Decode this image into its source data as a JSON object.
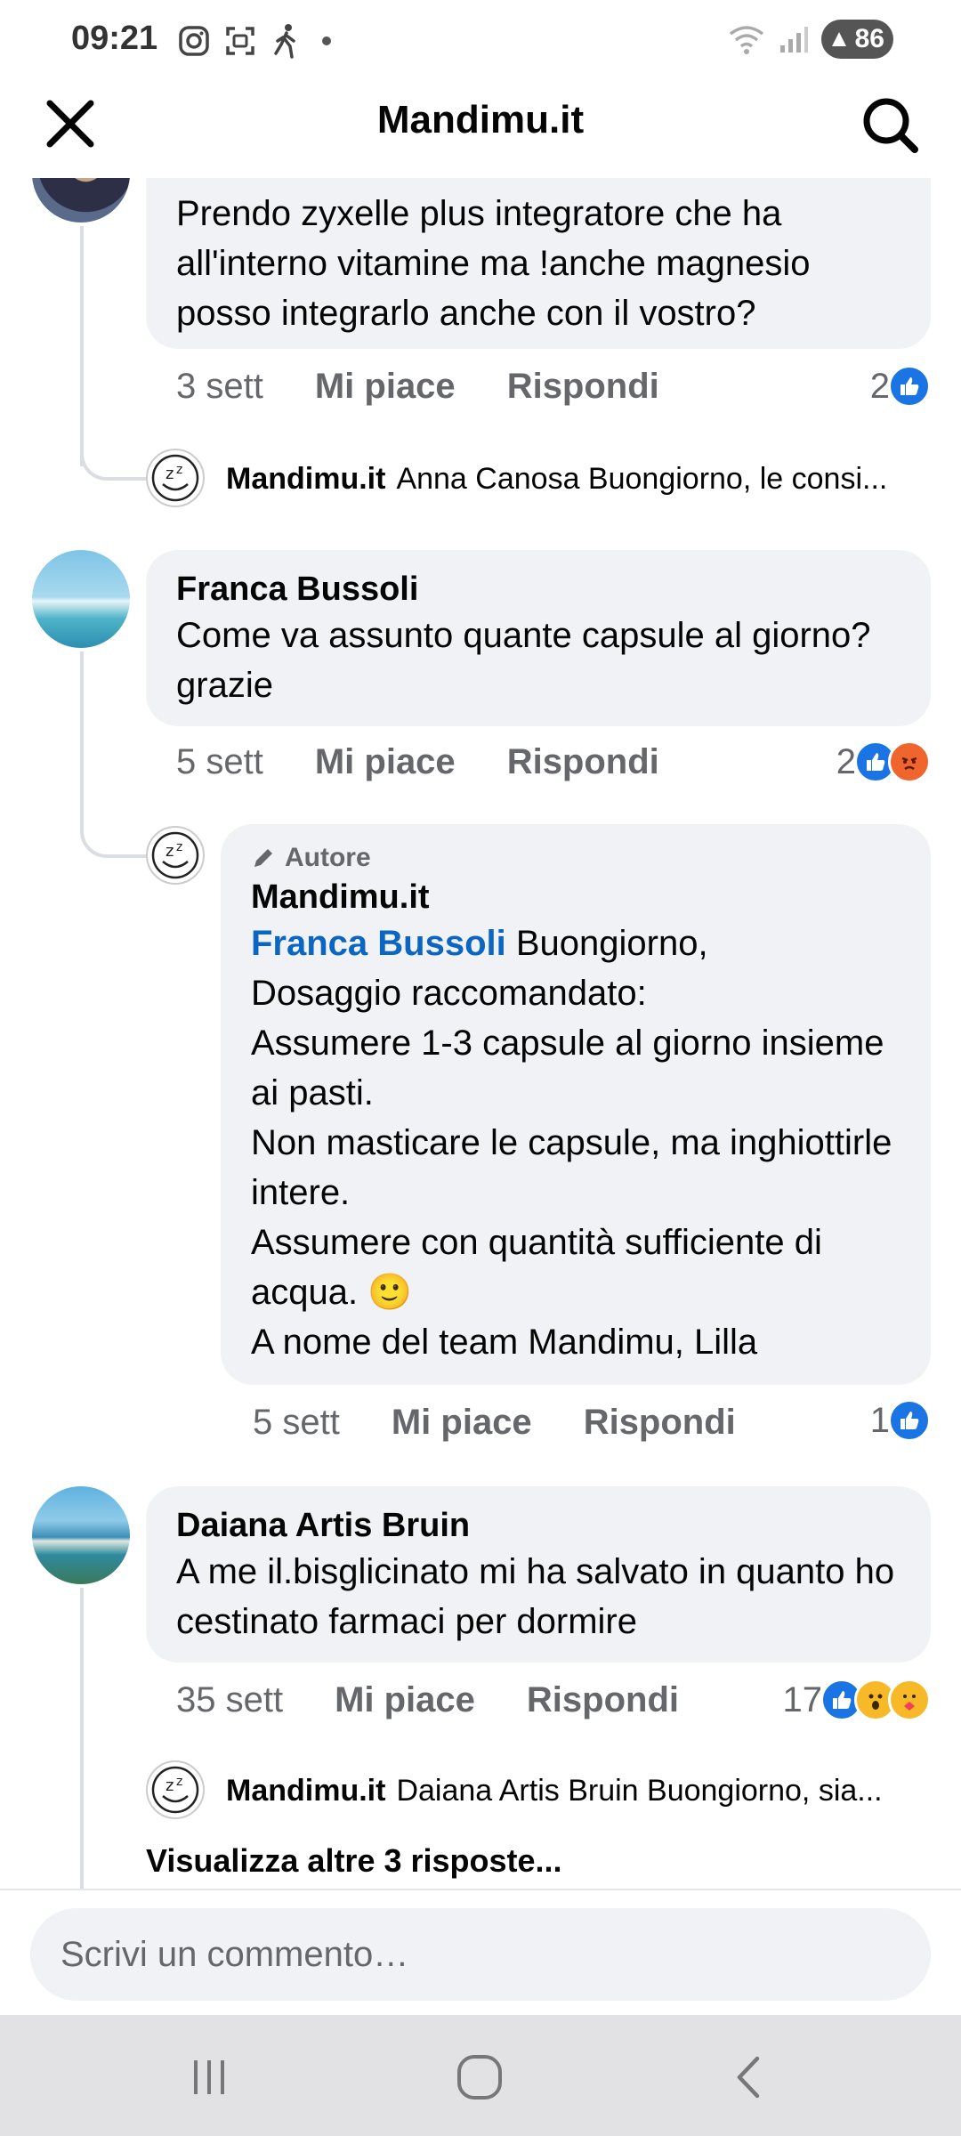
{
  "status_bar": {
    "time": "09:21",
    "battery": "86"
  },
  "header": {
    "title": "Mandimu.it"
  },
  "comments": [
    {
      "text": "Prendo zyxelle plus integratore che ha all'interno vitamine ma !anche magnesio posso integrarlo anche con il vostro?",
      "time": "3 sett",
      "like_label": "Mi piace",
      "reply_label": "Rispondi",
      "reaction_count": "2",
      "reactions": [
        "like-icon"
      ],
      "reply_preview": {
        "name": "Mandimu.it",
        "text": "Anna Canosa Buongiorno, le consi..."
      }
    },
    {
      "name": "Franca Bussoli",
      "text": "Come va assunto quante capsule al giorno?grazie",
      "time": "5 sett",
      "like_label": "Mi piace",
      "reply_label": "Rispondi",
      "reaction_count": "2",
      "reactions": [
        "like-icon",
        "angry-icon"
      ],
      "reply": {
        "badge": "Autore",
        "name": "Mandimu.it",
        "mention": "Franca Bussoli",
        "text_first": " Buongiorno,",
        "text_rest": "Dosaggio raccomandato:\nAssumere 1-3 capsule al giorno insieme ai pasti.\nNon masticare le capsule, ma inghiottirle intere.\nAssumere con quantità sufficiente di acqua. 🙂\nA nome del team Mandimu, Lilla",
        "time": "5 sett",
        "like_label": "Mi piace",
        "reply_label": "Rispondi",
        "reaction_count": "1"
      }
    },
    {
      "name": "Daiana Artis Bruin",
      "text": "A me il.bisglicinato mi ha salvato in quanto ho cestinato farmaci per dormire",
      "time": "35 sett",
      "like_label": "Mi piace",
      "reply_label": "Rispondi",
      "reaction_count": "17",
      "reactions": [
        "like-icon",
        "wow-icon",
        "care-icon"
      ],
      "reply_preview": {
        "name": "Mandimu.it",
        "text": "Daiana Artis Bruin Buongiorno, sia..."
      },
      "more_replies": "Visualizza altre 3 risposte..."
    }
  ],
  "composer": {
    "placeholder": "Scrivi un commento…"
  }
}
